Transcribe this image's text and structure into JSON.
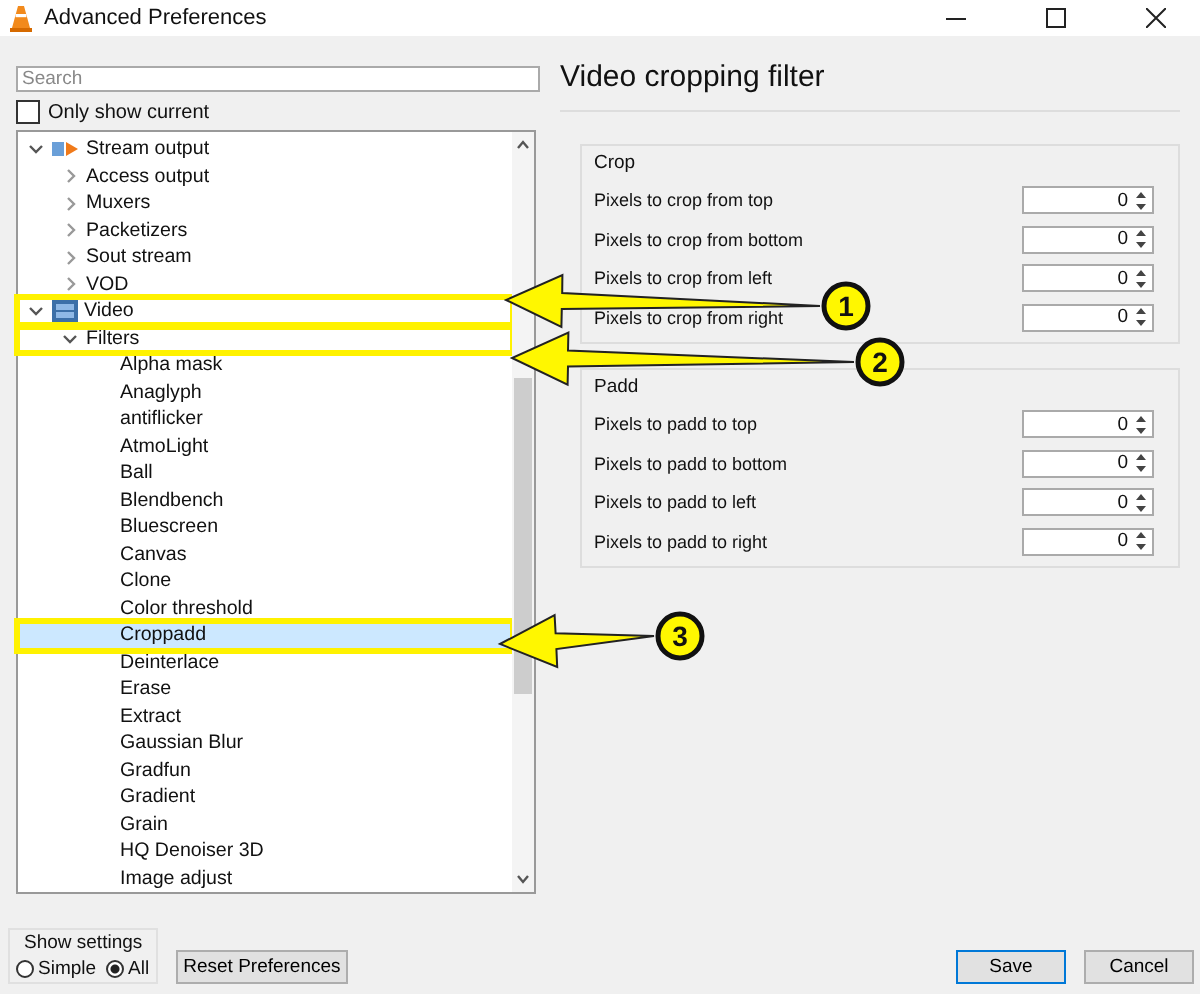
{
  "window": {
    "title": "Advanced Preferences"
  },
  "search": {
    "placeholder": "Search"
  },
  "only_show_current": {
    "label": "Only show current",
    "checked": false
  },
  "tree": {
    "items": [
      {
        "label": "Stream output",
        "kind": "stream",
        "expanded": true,
        "selected": false,
        "highlighted": false,
        "children": [
          {
            "label": "Access output",
            "expanded": false,
            "selected": false,
            "highlighted": false
          },
          {
            "label": "Muxers",
            "expanded": false,
            "selected": false,
            "highlighted": false
          },
          {
            "label": "Packetizers",
            "expanded": false,
            "selected": false,
            "highlighted": false
          },
          {
            "label": "Sout stream",
            "expanded": false,
            "selected": false,
            "highlighted": false
          },
          {
            "label": "VOD",
            "expanded": false,
            "selected": false,
            "highlighted": false
          }
        ]
      },
      {
        "label": "Video",
        "kind": "video",
        "expanded": true,
        "selected": false,
        "highlighted": true,
        "children": [
          {
            "label": "Filters",
            "expanded": true,
            "selected": false,
            "highlighted": true,
            "children": [
              {
                "label": "Alpha mask",
                "selected": false,
                "highlighted": false
              },
              {
                "label": "Anaglyph",
                "selected": false,
                "highlighted": false
              },
              {
                "label": "antiflicker",
                "selected": false,
                "highlighted": false
              },
              {
                "label": "AtmoLight",
                "selected": false,
                "highlighted": false
              },
              {
                "label": "Ball",
                "selected": false,
                "highlighted": false
              },
              {
                "label": "Blendbench",
                "selected": false,
                "highlighted": false
              },
              {
                "label": "Bluescreen",
                "selected": false,
                "highlighted": false
              },
              {
                "label": "Canvas",
                "selected": false,
                "highlighted": false
              },
              {
                "label": "Clone",
                "selected": false,
                "highlighted": false
              },
              {
                "label": "Color threshold",
                "selected": false,
                "highlighted": false
              },
              {
                "label": "Croppadd",
                "selected": true,
                "highlighted": true
              },
              {
                "label": "Deinterlace",
                "selected": false,
                "highlighted": false
              },
              {
                "label": "Erase",
                "selected": false,
                "highlighted": false
              },
              {
                "label": "Extract",
                "selected": false,
                "highlighted": false
              },
              {
                "label": "Gaussian Blur",
                "selected": false,
                "highlighted": false
              },
              {
                "label": "Gradfun",
                "selected": false,
                "highlighted": false
              },
              {
                "label": "Gradient",
                "selected": false,
                "highlighted": false
              },
              {
                "label": "Grain",
                "selected": false,
                "highlighted": false
              },
              {
                "label": "HQ Denoiser 3D",
                "selected": false,
                "highlighted": false
              },
              {
                "label": "Image adjust",
                "selected": false,
                "highlighted": false
              }
            ]
          }
        ]
      }
    ]
  },
  "panel": {
    "title": "Video cropping filter",
    "groups": [
      {
        "title": "Crop",
        "fields": [
          {
            "label": "Pixels to crop from top",
            "value": "0"
          },
          {
            "label": "Pixels to crop from bottom",
            "value": "0"
          },
          {
            "label": "Pixels to crop from left",
            "value": "0"
          },
          {
            "label": "Pixels to crop from right",
            "value": "0"
          }
        ]
      },
      {
        "title": "Padd",
        "fields": [
          {
            "label": "Pixels to padd to top",
            "value": "0"
          },
          {
            "label": "Pixels to padd to bottom",
            "value": "0"
          },
          {
            "label": "Pixels to padd to left",
            "value": "0"
          },
          {
            "label": "Pixels to padd to right",
            "value": "0"
          }
        ]
      }
    ]
  },
  "show_settings": {
    "title": "Show settings",
    "options": [
      {
        "label": "Simple",
        "selected": false
      },
      {
        "label": "All",
        "selected": true
      }
    ]
  },
  "buttons": [
    {
      "label": "Reset Preferences",
      "kind": "reset",
      "default": false
    },
    {
      "label": "Save",
      "kind": "save",
      "default": true
    },
    {
      "label": "Cancel",
      "kind": "cancel",
      "default": false
    }
  ],
  "annotations": [
    {
      "number": "1"
    },
    {
      "number": "2"
    },
    {
      "number": "3"
    }
  ]
}
